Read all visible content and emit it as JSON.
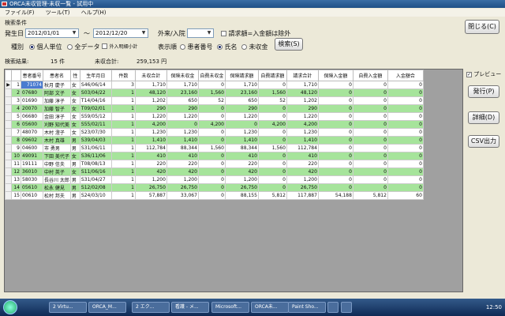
{
  "window": {
    "title": "ORCA未収管理-未収一覧 - 試用中"
  },
  "menu": [
    "ファイル(F)",
    "ツール(T)",
    "ヘルプ(H)"
  ],
  "conditions": {
    "section_label": "検索条件",
    "date_label": "発生日",
    "date_from": "2012/01/01",
    "date_sep": "～",
    "date_to": "2012/12/20",
    "inout_label": "外来/入院",
    "exclude_label": "請求額=入金額は除外",
    "kind_label": "種別",
    "kind_options": [
      "個人単位",
      "全データ",
      "外入明細小計"
    ],
    "kind_selected": 0,
    "order_label": "表示順",
    "order_options": [
      "患者番号",
      "氏名",
      "未収金"
    ],
    "order_selected": 1,
    "search_button": "検索(S)"
  },
  "summary": {
    "result_label": "検索結果:",
    "result_value": "15 件",
    "total_label": "未収合計:",
    "total_value": "259,153 円"
  },
  "buttons": {
    "close": "閉じる(C)",
    "preview": "プレビュー",
    "issue": "発行(P)",
    "detail": "詳細(D)",
    "csv": "CSV出力"
  },
  "table": {
    "headers": [
      "患者番号",
      "患者名",
      "性",
      "生年月日",
      "件数",
      "未収合計",
      "保険未収金",
      "自費未収金",
      "保険請求額",
      "自費請求額",
      "請求合計",
      "保険入金額",
      "自費入金額",
      "入金額合"
    ],
    "rows": [
      [
        "71074",
        "秋月 慶子",
        "女",
        "S46/06/14",
        "3",
        "1,710",
        "1,710",
        "0",
        "1,710",
        "0",
        "1,710",
        "0",
        "0",
        "0"
      ],
      [
        "07680",
        "阿部 文子",
        "女",
        "S03/04/22",
        "1",
        "48,120",
        "23,160",
        "1,560",
        "23,160",
        "1,560",
        "48,120",
        "0",
        "0",
        "0"
      ],
      [
        "01690",
        "加藤 淳子",
        "女",
        "T14/04/16",
        "1",
        "1,202",
        "650",
        "52",
        "650",
        "52",
        "1,202",
        "0",
        "0",
        "0"
      ],
      [
        "20070",
        "加藤 智子",
        "女",
        "T09/02/01",
        "1",
        "290",
        "290",
        "0",
        "290",
        "0",
        "290",
        "0",
        "0",
        "0"
      ],
      [
        "06680",
        "金田 淳子",
        "女",
        "S59/05/12",
        "1",
        "1,220",
        "1,220",
        "0",
        "1,220",
        "0",
        "1,220",
        "0",
        "0",
        "0"
      ],
      [
        "05600",
        "刈野 知代美",
        "女",
        "S55/02/11",
        "1",
        "4,200",
        "0",
        "4,200",
        "0",
        "4,200",
        "4,200",
        "0",
        "0",
        "0"
      ],
      [
        "48070",
        "木村 澄子",
        "女",
        "S23/07/30",
        "1",
        "1,230",
        "1,230",
        "0",
        "1,230",
        "0",
        "1,230",
        "0",
        "0",
        "0"
      ],
      [
        "09602",
        "木村 真雄",
        "男",
        "S39/04/03",
        "1",
        "1,410",
        "1,410",
        "0",
        "1,410",
        "0",
        "1,410",
        "0",
        "0",
        "0"
      ],
      [
        "04600",
        "市 勇男",
        "男",
        "S31/06/11",
        "1",
        "112,784",
        "88,344",
        "1,560",
        "88,344",
        "1,560",
        "112,784",
        "0",
        "0",
        "0"
      ],
      [
        "49091",
        "下田 美代子",
        "女",
        "S36/11/06",
        "1",
        "410",
        "410",
        "0",
        "410",
        "0",
        "410",
        "0",
        "0",
        "0"
      ],
      [
        "19111",
        "中野 信夫",
        "男",
        "T08/08/13",
        "1",
        "220",
        "220",
        "0",
        "220",
        "0",
        "220",
        "0",
        "0",
        "0"
      ],
      [
        "36010",
        "中村 英子",
        "女",
        "S11/06/16",
        "1",
        "420",
        "420",
        "0",
        "420",
        "0",
        "420",
        "0",
        "0",
        "0"
      ],
      [
        "58030",
        "長谷川 太郎",
        "男",
        "S31/04/27",
        "1",
        "1,200",
        "1,200",
        "0",
        "1,200",
        "0",
        "1,200",
        "0",
        "0",
        "0"
      ],
      [
        "05610",
        "松永 健見",
        "男",
        "S12/02/08",
        "1",
        "26,750",
        "26,750",
        "0",
        "26,750",
        "0",
        "26,750",
        "0",
        "0",
        "0"
      ],
      [
        "00610",
        "松村 邦夫",
        "男",
        "S24/03/10",
        "1",
        "57,887",
        "33,067",
        "0",
        "88,155",
        "5,812",
        "117,887",
        "54,188",
        "5,812",
        "60"
      ]
    ]
  },
  "taskbar": {
    "items": [
      "2 Virtu...",
      "ORCA_M...",
      "2 エク...",
      "看護 - メ...",
      "Microsoft...",
      "ORCA未...",
      "Paint Sho...",
      "",
      ""
    ],
    "clock": "12:50"
  }
}
